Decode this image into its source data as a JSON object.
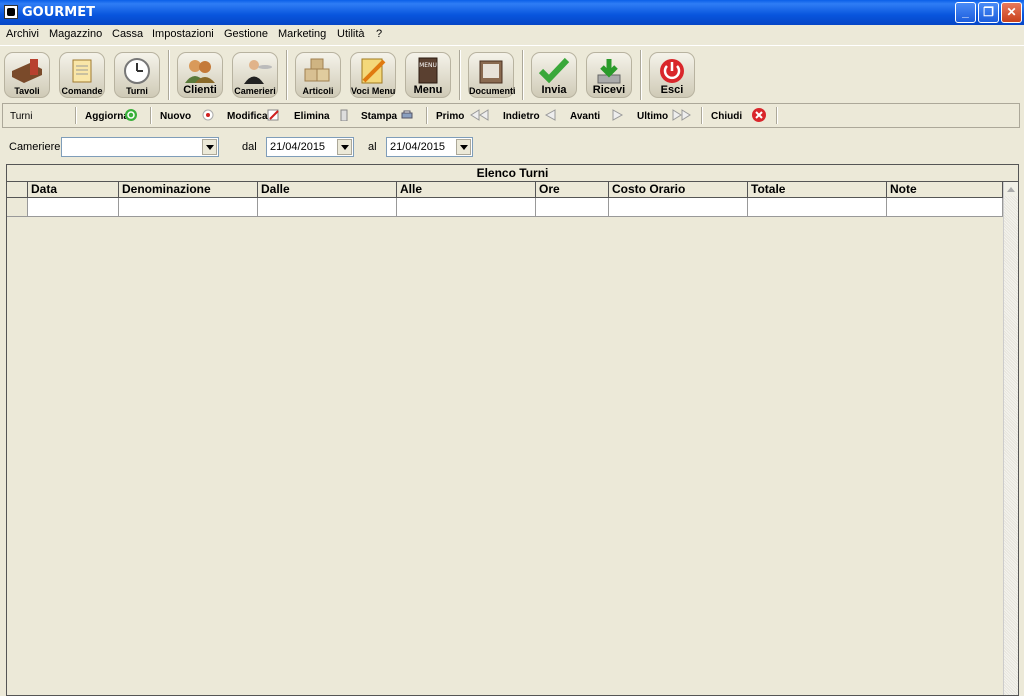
{
  "window": {
    "title": "GOURMET"
  },
  "menu": [
    "Archivi",
    "Magazzino",
    "Cassa",
    "Impostazioni",
    "Gestione",
    "Marketing",
    "Utilità",
    "?"
  ],
  "toolbar": {
    "tavoli": "Tavoli",
    "comande": "Comande",
    "turni": "Turni",
    "clienti": "Clienti",
    "camerieri": "Camerieri",
    "articoli": "Articoli",
    "voci_menu": "Voci Menu",
    "menu": "Menu",
    "documenti": "Documenti",
    "invia": "Invia",
    "ricevi": "Ricevi",
    "esci": "Esci"
  },
  "secondary": {
    "section": "Turni",
    "aggiorna": "Aggiorna",
    "nuovo": "Nuovo",
    "modifica": "Modifica",
    "elimina": "Elimina",
    "stampa": "Stampa",
    "primo": "Primo",
    "indietro": "Indietro",
    "avanti": "Avanti",
    "ultimo": "Ultimo",
    "chiudi": "Chiudi"
  },
  "filters": {
    "cameriere_label": "Cameriere",
    "cameriere_value": "",
    "dal_label": "dal",
    "dal_value": "21/04/2015",
    "al_label": "al",
    "al_value": "21/04/2015"
  },
  "grid": {
    "caption": "Elenco Turni",
    "columns": [
      "Data",
      "Denominazione",
      "Dalle",
      "Alle",
      "Ore",
      "Costo Orario",
      "Totale",
      "Note"
    ]
  }
}
